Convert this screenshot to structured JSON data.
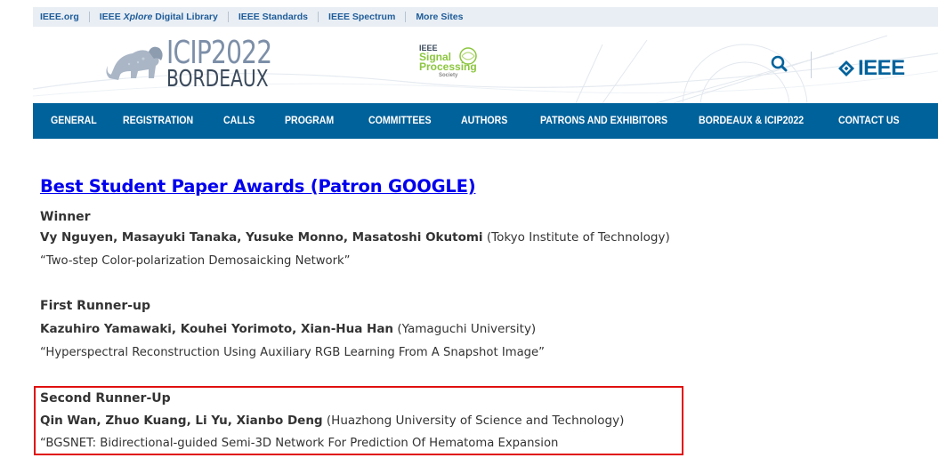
{
  "topbar": {
    "links": [
      {
        "label": "IEEE.org"
      },
      {
        "label_prefix": "IEEE ",
        "label_italic": "Xplore",
        "label_suffix": " Digital Library"
      },
      {
        "label": "IEEE Standards"
      },
      {
        "label": "IEEE Spectrum"
      },
      {
        "label": "More Sites"
      }
    ]
  },
  "header": {
    "logo_line1": "ICIP2022",
    "logo_line2": "BORDEAUX",
    "sps_ieee": "IEEE",
    "sps_signal": "Signal",
    "sps_processing": "Processing",
    "sps_society": "Society",
    "ieee_word": "IEEE",
    "icons": {
      "search": "search-icon",
      "ieee_logo": "ieee-diamond-icon",
      "lion": "lion-icon"
    },
    "colors": {
      "brand_blue": "#00629b",
      "sps_green": "#8cc63f"
    }
  },
  "nav": {
    "items": [
      {
        "label": "GENERAL"
      },
      {
        "label": "REGISTRATION"
      },
      {
        "label": "CALLS"
      },
      {
        "label": "PROGRAM"
      },
      {
        "label": "COMMITTEES"
      },
      {
        "label": "AUTHORS"
      },
      {
        "label": "PATRONS AND EXHIBITORS"
      },
      {
        "label": "BORDEAUX & ICIP2022"
      },
      {
        "label": "CONTACT US"
      }
    ]
  },
  "content": {
    "heading": "Best Student Paper Awards (Patron GOOGLE)",
    "awards": [
      {
        "title": "Winner",
        "names": "Vy Nguyen, Masayuki Tanaka, Yusuke Monno, Masatoshi Okutomi",
        "affiliation": " (Tokyo Institute of Technology)",
        "paper": "“Two-step Color-polarization Demosaicking Network”"
      },
      {
        "title": "First Runner-up",
        "names": "Kazuhiro Yamawaki, Kouhei Yorimoto, Xian-Hua Han",
        "affiliation": " (Yamaguchi University)",
        "paper": "“Hyperspectral Reconstruction Using Auxiliary RGB Learning From A Snapshot Image”"
      },
      {
        "title": "Second Runner-Up",
        "names": "Qin Wan, Zhuo Kuang, Li Yu, Xianbo Deng",
        "affiliation": " (Huazhong University of Science and Technology)",
        "paper": "“BGSNET: Bidirectional-guided Semi-3D Network For Prediction Of Hematoma Expansion"
      }
    ],
    "highlight_color": "#e01010"
  }
}
